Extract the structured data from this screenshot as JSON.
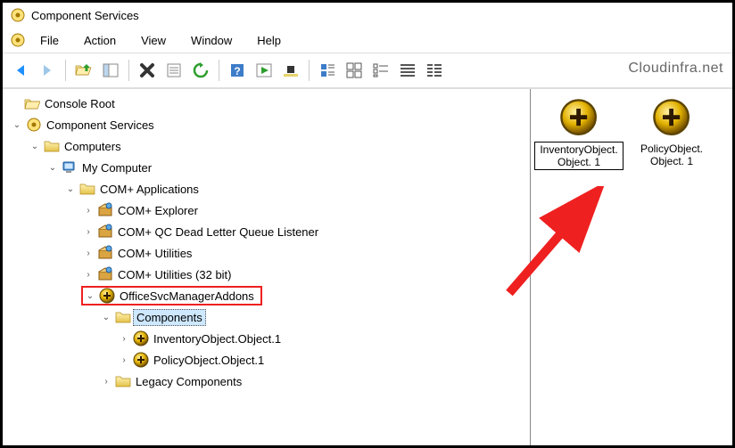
{
  "window": {
    "title": "Component Services"
  },
  "menu": {
    "file": "File",
    "action": "Action",
    "view": "View",
    "window": "Window",
    "help": "Help"
  },
  "watermark": "Cloudinfra.net",
  "tree": {
    "root": "Console Root",
    "cs": "Component Services",
    "computers": "Computers",
    "my_computer": "My Computer",
    "com_apps": "COM+ Applications",
    "com_explorer": "COM+ Explorer",
    "com_qc": "COM+ QC Dead Letter Queue Listener",
    "com_util": "COM+ Utilities",
    "com_util32": "COM+ Utilities (32 bit)",
    "office": "OfficeSvcManagerAddons",
    "components": "Components",
    "inventory": "InventoryObject.Object.1",
    "policy": "PolicyObject.Object.1",
    "legacy": "Legacy Components"
  },
  "right": {
    "item1": "InventoryObject. Object. 1",
    "item2": "PolicyObject. Object. 1"
  }
}
